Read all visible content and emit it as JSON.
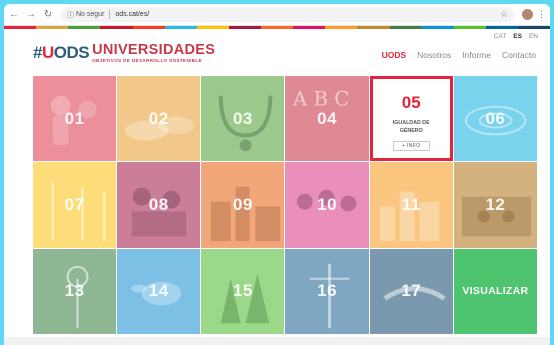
{
  "browser": {
    "security_label": "No segur",
    "url": "ods.cat/es/"
  },
  "rainbow": [
    "#e5243b",
    "#dda63a",
    "#4c9f38",
    "#c5192d",
    "#ff3a21",
    "#26bde2",
    "#fcc30b",
    "#a21942",
    "#fd6925",
    "#dd1367",
    "#fd9d24",
    "#bf8b2e",
    "#3f7e44",
    "#0a97d9",
    "#56c02b",
    "#00689d",
    "#19486a"
  ],
  "languages": [
    "CAT",
    "ES",
    "EN"
  ],
  "active_language": "ES",
  "logo": {
    "hash": "#",
    "u": "U",
    "ods": "ODS",
    "title": "UNIVERSIDADES",
    "subtitle": "OBJETIVOS DE DESARROLLO SOSTENIBLE"
  },
  "nav": [
    "UODS",
    "Nosotros",
    "Informe",
    "Contacto"
  ],
  "tiles": [
    {
      "num": "01",
      "color": "#ec8f9a",
      "icon": "children-icon"
    },
    {
      "num": "02",
      "color": "#f1c889",
      "icon": "hands-icon"
    },
    {
      "num": "03",
      "color": "#9cc98c",
      "icon": "stethoscope-icon"
    },
    {
      "num": "04",
      "color": "#df8995",
      "icon": "blackboard-icon"
    },
    {
      "num": "05",
      "color": "#ffffff",
      "icon": "featured"
    },
    {
      "num": "06",
      "color": "#79d3ec",
      "icon": "water-icon"
    },
    {
      "num": "07",
      "color": "#fcdd79",
      "icon": "wind-turbine-icon"
    },
    {
      "num": "08",
      "color": "#cc7d98",
      "icon": "workers-icon"
    },
    {
      "num": "09",
      "color": "#f2a77b",
      "icon": "industry-icon"
    },
    {
      "num": "10",
      "color": "#e98fb9",
      "icon": "crowd-icon"
    },
    {
      "num": "11",
      "color": "#f9c57f",
      "icon": "city-icon"
    },
    {
      "num": "12",
      "color": "#d4b27f",
      "icon": "market-icon"
    },
    {
      "num": "13",
      "color": "#90b794",
      "icon": "windmill-icon"
    },
    {
      "num": "14",
      "color": "#7cc0e6",
      "icon": "sea-turtle-icon"
    },
    {
      "num": "15",
      "color": "#9cd88a",
      "icon": "forest-icon"
    },
    {
      "num": "16",
      "color": "#7fa7c2",
      "icon": "justice-statue-icon"
    },
    {
      "num": "17",
      "color": "#7a98ae",
      "icon": "handshake-icon"
    }
  ],
  "featured": {
    "num": "05",
    "title": "IGUALDAD DE GÉNERO",
    "button": "+ INFO"
  },
  "visualizar": "VISUALIZAR"
}
